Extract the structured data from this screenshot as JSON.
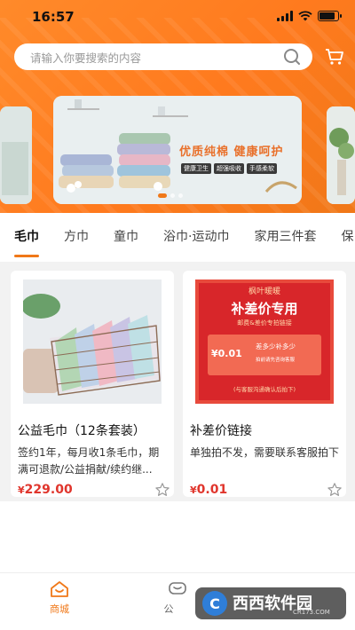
{
  "status_bar": {
    "time": "16:57"
  },
  "search": {
    "placeholder": "请输入你要搜索的内容"
  },
  "banner": {
    "title": "优质纯棉  健康呵护",
    "tags": [
      "健康卫生",
      "超强吸收",
      "手感柔软"
    ]
  },
  "categories": [
    "毛巾",
    "方巾",
    "童巾",
    "浴巾·运动巾",
    "家用三件套",
    "保"
  ],
  "products": [
    {
      "title": "公益毛巾（12条套装）",
      "description": "签约1年，每月收1条毛巾，期满可退款/公益捐献/续约继...",
      "price": "229.00",
      "currency": "¥"
    },
    {
      "title": "补差价链接",
      "description": "单独拍不发，需要联系客服拍下",
      "price": "0.01",
      "currency": "¥",
      "image": {
        "brand": "枫叶暖暖",
        "heading": "补差价专用",
        "subheading": "邮费&差价专拍链接",
        "ticket_label": "差多少补多少",
        "ticket_price": "¥0.01",
        "ticket_note": "拍前请先咨询客服",
        "footer": "(与客服沟通确认后拍下)"
      }
    }
  ],
  "bottom_nav": [
    {
      "label": "商城",
      "icon": "home-icon",
      "active": true
    },
    {
      "label": "公",
      "icon": "chat-icon",
      "active": false
    }
  ],
  "watermark": {
    "text": "西西软件园",
    "sub": "CR173.COM"
  },
  "colors": {
    "accent": "#f07818",
    "price": "#e0352c",
    "header": "#ff7a1e"
  }
}
